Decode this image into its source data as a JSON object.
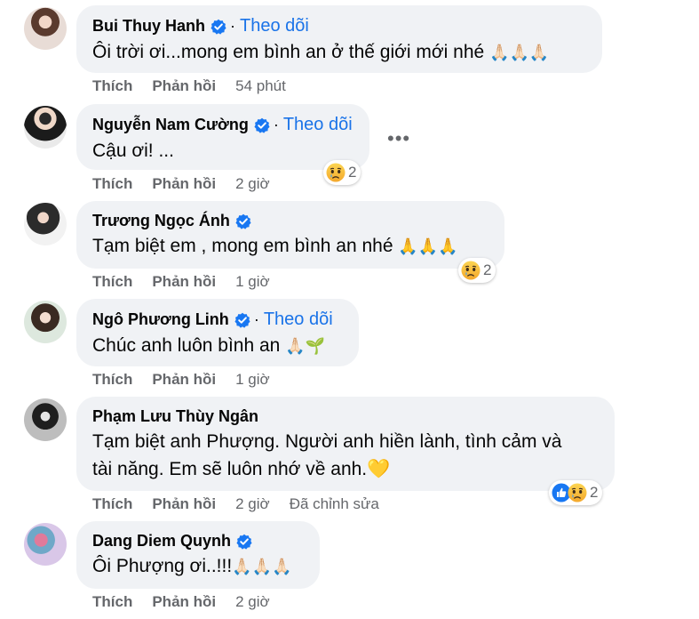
{
  "comments": [
    {
      "name": "Bui Thuy Hanh",
      "follow": "Theo dõi",
      "text": "Ôi trời ơi...mong em bình an ở thế giới mới nhé",
      "emoji": "🙏🏻🙏🏻🙏🏻",
      "like": "Thích",
      "reply": "Phản hồi",
      "time": "54 phút"
    },
    {
      "name": "Nguyễn Nam Cường",
      "follow": "Theo dõi",
      "text": "Cậu ơi! ...",
      "like": "Thích",
      "reply": "Phản hồi",
      "time": "2 giờ",
      "reaction_count": "2",
      "more": "•••"
    },
    {
      "name": "Trương Ngọc Ánh",
      "text": "Tạm biệt em , mong em bình an nhé",
      "emoji": "🙏🙏🙏",
      "like": "Thích",
      "reply": "Phản hồi",
      "time": "1 giờ",
      "reaction_count": "2"
    },
    {
      "name": "Ngô Phương Linh",
      "follow": "Theo dõi",
      "text": "Chúc anh luôn bình an",
      "emoji": "🙏🏻🌱",
      "like": "Thích",
      "reply": "Phản hồi",
      "time": "1 giờ"
    },
    {
      "name": "Phạm Lưu Thùy Ngân",
      "text_line1": "Tạm biệt anh Phượng. Người anh hiền lành, tình cảm và",
      "text_line2": "tài năng. Em sẽ luôn nhớ về anh.",
      "emoji": "💛",
      "like": "Thích",
      "reply": "Phản hồi",
      "time": "2 giờ",
      "edited": "Đã chỉnh sửa",
      "reaction_count": "2"
    },
    {
      "name": "Dang Diem Quynh",
      "text": "Ôi Phượng ơi..!!!",
      "emoji": "🙏🏻🙏🏻🙏🏻",
      "like": "Thích",
      "reply": "Phản hồi",
      "time": "2 giờ"
    }
  ],
  "colors": {
    "bubble": "#f0f2f5",
    "link_blue": "#1a73e8",
    "verified_blue": "#1877f2",
    "meta_gray": "#65676b"
  },
  "icons": [
    "verified-badge-icon",
    "sad-reaction-icon",
    "like-reaction-icon",
    "more-options-icon"
  ]
}
